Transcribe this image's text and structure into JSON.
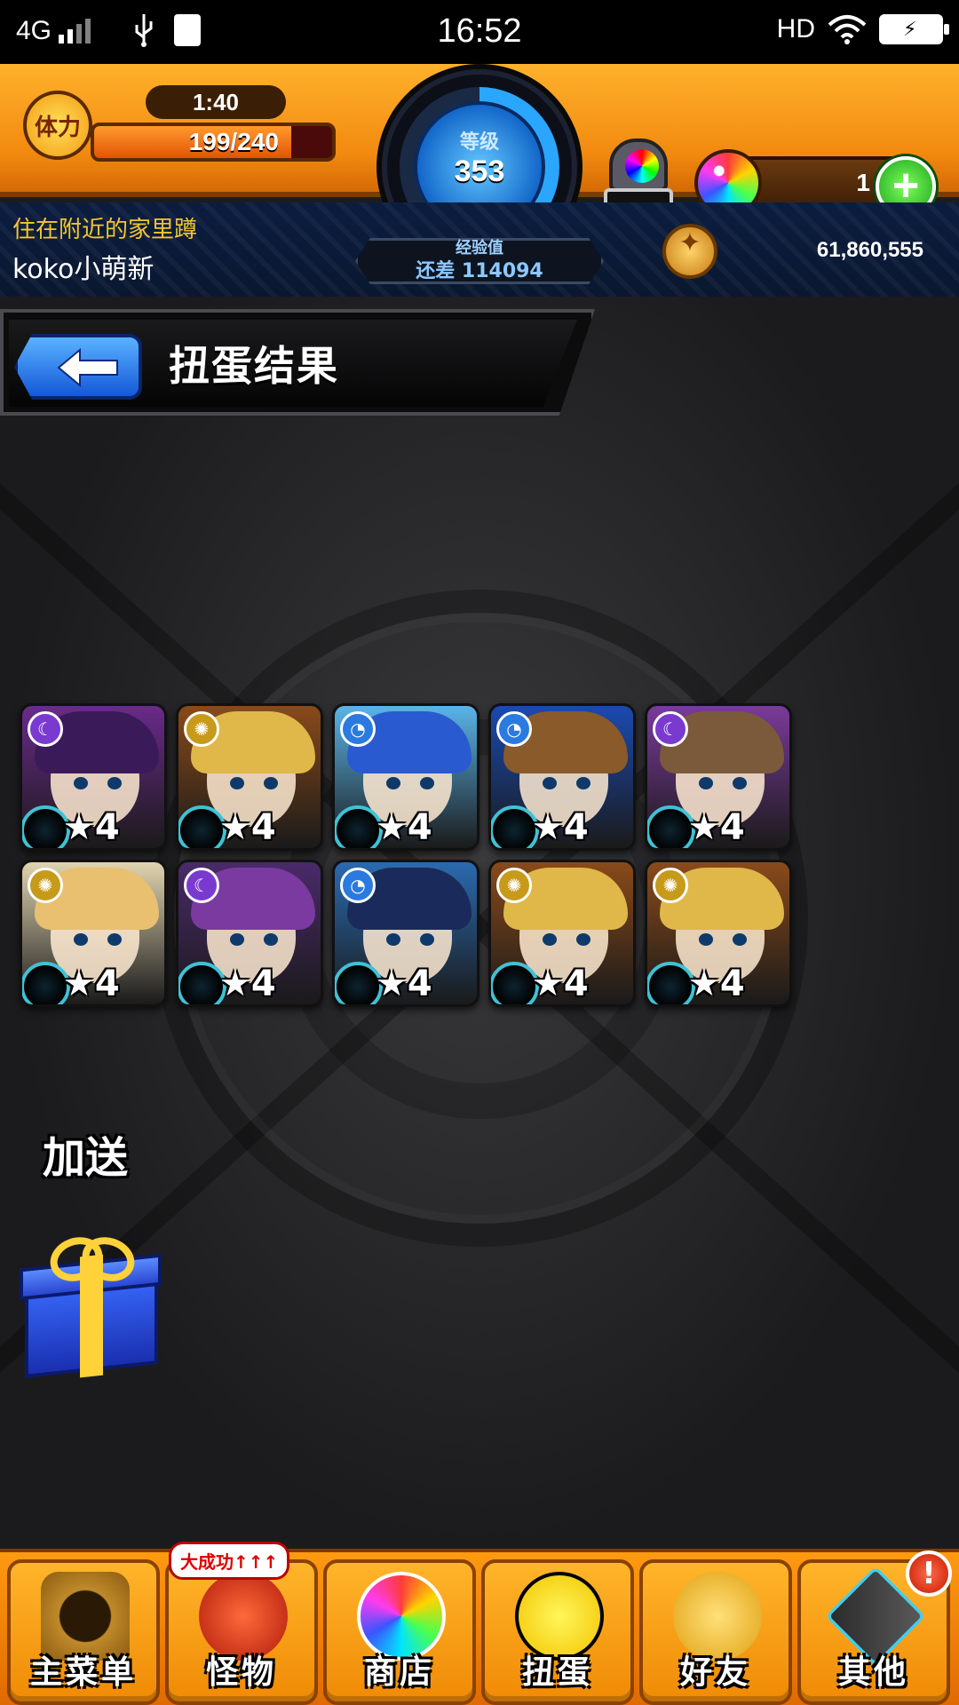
{
  "status_bar": {
    "network": "4G",
    "time": "16:52",
    "hd": "HD"
  },
  "header": {
    "stamina_label": "体力",
    "stamina_timer": "1:40",
    "stamina_value": "199/240",
    "stamina_fraction": 0.829,
    "level_label": "等级",
    "level_value": "353",
    "exp_label": "经验值",
    "exp_remaining": "还差 114094",
    "gacha_machine_display": "---",
    "orb_count": "1"
  },
  "player": {
    "nickname": "住在附近的家里蹲",
    "username": "koko小萌新",
    "coins": "61,860,555"
  },
  "page": {
    "title": "扭蛋结果"
  },
  "results": [
    {
      "rarity": "★4",
      "attribute": "dark",
      "hair": "#3b1a5a",
      "bg": "#6a2a8a"
    },
    {
      "rarity": "★4",
      "attribute": "light",
      "hair": "#e0b84a",
      "bg": "#8a4a1a"
    },
    {
      "rarity": "★4",
      "attribute": "water",
      "hair": "#2a5ad0",
      "bg": "#5ab4e8"
    },
    {
      "rarity": "★4",
      "attribute": "water",
      "hair": "#8a5a2a",
      "bg": "#1a4ab0"
    },
    {
      "rarity": "★4",
      "attribute": "dark",
      "hair": "#7a5a3a",
      "bg": "#7a3a9a"
    },
    {
      "rarity": "★4",
      "attribute": "light",
      "hair": "#e8c070",
      "bg": "#e0d4b0"
    },
    {
      "rarity": "★4",
      "attribute": "dark",
      "hair": "#7a3aa0",
      "bg": "#4a2a6a"
    },
    {
      "rarity": "★4",
      "attribute": "water",
      "hair": "#1a2a5a",
      "bg": "#2a6ab0"
    },
    {
      "rarity": "★4",
      "attribute": "light",
      "hair": "#e0b84a",
      "bg": "#8a4a1a"
    },
    {
      "rarity": "★4",
      "attribute": "light",
      "hair": "#e0b84a",
      "bg": "#8a4a1a"
    }
  ],
  "bonus": {
    "label": "加送"
  },
  "nav": {
    "items": [
      {
        "label": "主菜单",
        "icon": "gate-icon"
      },
      {
        "label": "怪物",
        "icon": "monster-icon",
        "badge": "大成功↑↑↑"
      },
      {
        "label": "商店",
        "icon": "orb-icon"
      },
      {
        "label": "扭蛋",
        "icon": "egg-icon"
      },
      {
        "label": "好友",
        "icon": "friends-icon"
      },
      {
        "label": "其他",
        "icon": "other-icon",
        "alert": "!"
      }
    ]
  },
  "colors": {
    "header_orange": "#f28a10",
    "accent_blue": "#2aa6ff",
    "nick_yellow": "#f3c530"
  }
}
